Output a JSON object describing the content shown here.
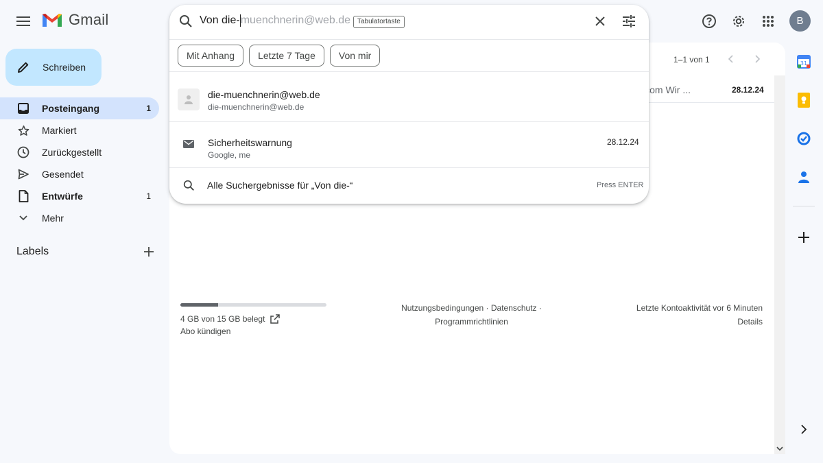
{
  "app": {
    "name": "Gmail",
    "avatar_letter": "B"
  },
  "compose": {
    "label": "Schreiben"
  },
  "nav": {
    "items": [
      {
        "label": "Posteingang",
        "count": "1",
        "icon": "inbox-icon",
        "active": true
      },
      {
        "label": "Markiert",
        "count": "",
        "icon": "star-icon"
      },
      {
        "label": "Zurückgestellt",
        "count": "",
        "icon": "clock-icon"
      },
      {
        "label": "Gesendet",
        "count": "",
        "icon": "send-icon"
      },
      {
        "label": "Entwürfe",
        "count": "1",
        "icon": "draft-icon"
      },
      {
        "label": "Mehr",
        "count": "",
        "icon": "chevron-down-icon"
      }
    ],
    "labels_heading": "Labels"
  },
  "search": {
    "typed": "Von die-",
    "suggestion_completion": "muenchnerin@web.de",
    "tab_hint": "Tabulatortaste",
    "chips": [
      "Mit Anhang",
      "Letzte 7 Tage",
      "Von mir"
    ],
    "contact": {
      "name": "die-muenchnerin@web.de",
      "email": "die-muenchnerin@web.de"
    },
    "mail": {
      "subject": "Sicherheitswarnung",
      "from": "Google, me",
      "date": "28.12.24"
    },
    "all_results": "Alle Suchergebnisse für „Von die-“",
    "press_enter": "Press ENTER"
  },
  "list": {
    "pager": "1–1 von 1",
    "row_preview": "il.com Wir ...",
    "row_date": "28.12.24"
  },
  "footer": {
    "storage_text": "4 GB von 15 GB belegt",
    "storage_fraction": 0.26,
    "abo": "Abo kündigen",
    "terms_line1": "Nutzungsbedingungen · Datenschutz ·",
    "terms_line2": "Programmrichtlinien",
    "activity_line1": "Letzte Kontoaktivität vor 6 Minuten",
    "activity_line2": "Details"
  },
  "colors": {
    "accent": "#c2e7ff",
    "active_nav": "#d3e3fd",
    "background": "#f6f8fc"
  }
}
